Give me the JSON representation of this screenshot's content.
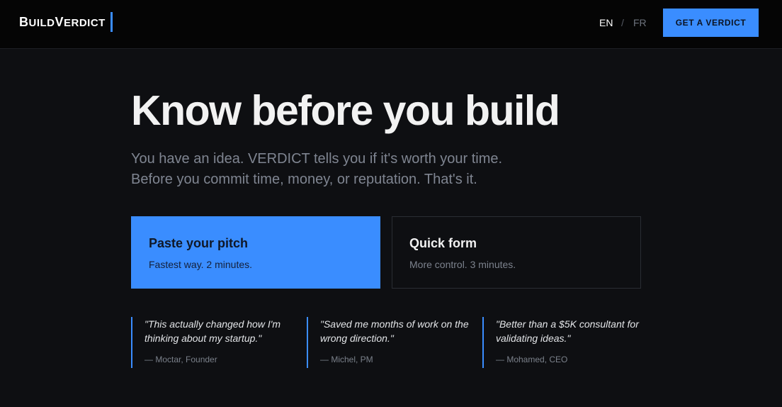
{
  "header": {
    "logo_first": "B",
    "logo_mid": "UILD",
    "logo_second": "V",
    "logo_rest": "ERDICT",
    "lang_en": "EN",
    "lang_sep": "/",
    "lang_fr": "FR",
    "cta_label": "GET A VERDICT"
  },
  "hero": {
    "title": "Know before you build",
    "subtitle_line1": "You have an idea. VERDICT tells you if it's worth your time.",
    "subtitle_line2": "Before you commit time, money, or reputation. That's it."
  },
  "options": [
    {
      "title": "Paste your pitch",
      "desc": "Fastest way. 2 minutes."
    },
    {
      "title": "Quick form",
      "desc": "More control. 3 minutes."
    }
  ],
  "testimonials": [
    {
      "quote": "\"This actually changed how I'm thinking about my startup.\"",
      "author": "— Moctar, Founder"
    },
    {
      "quote": "\"Saved me months of work on the wrong direction.\"",
      "author": "— Michel, PM"
    },
    {
      "quote": "\"Better than a $5K consultant for validating ideas.\"",
      "author": "— Mohamed, CEO"
    }
  ],
  "colors": {
    "accent": "#3a8dff",
    "background": "#0e0f12",
    "header_bg": "#050505"
  }
}
